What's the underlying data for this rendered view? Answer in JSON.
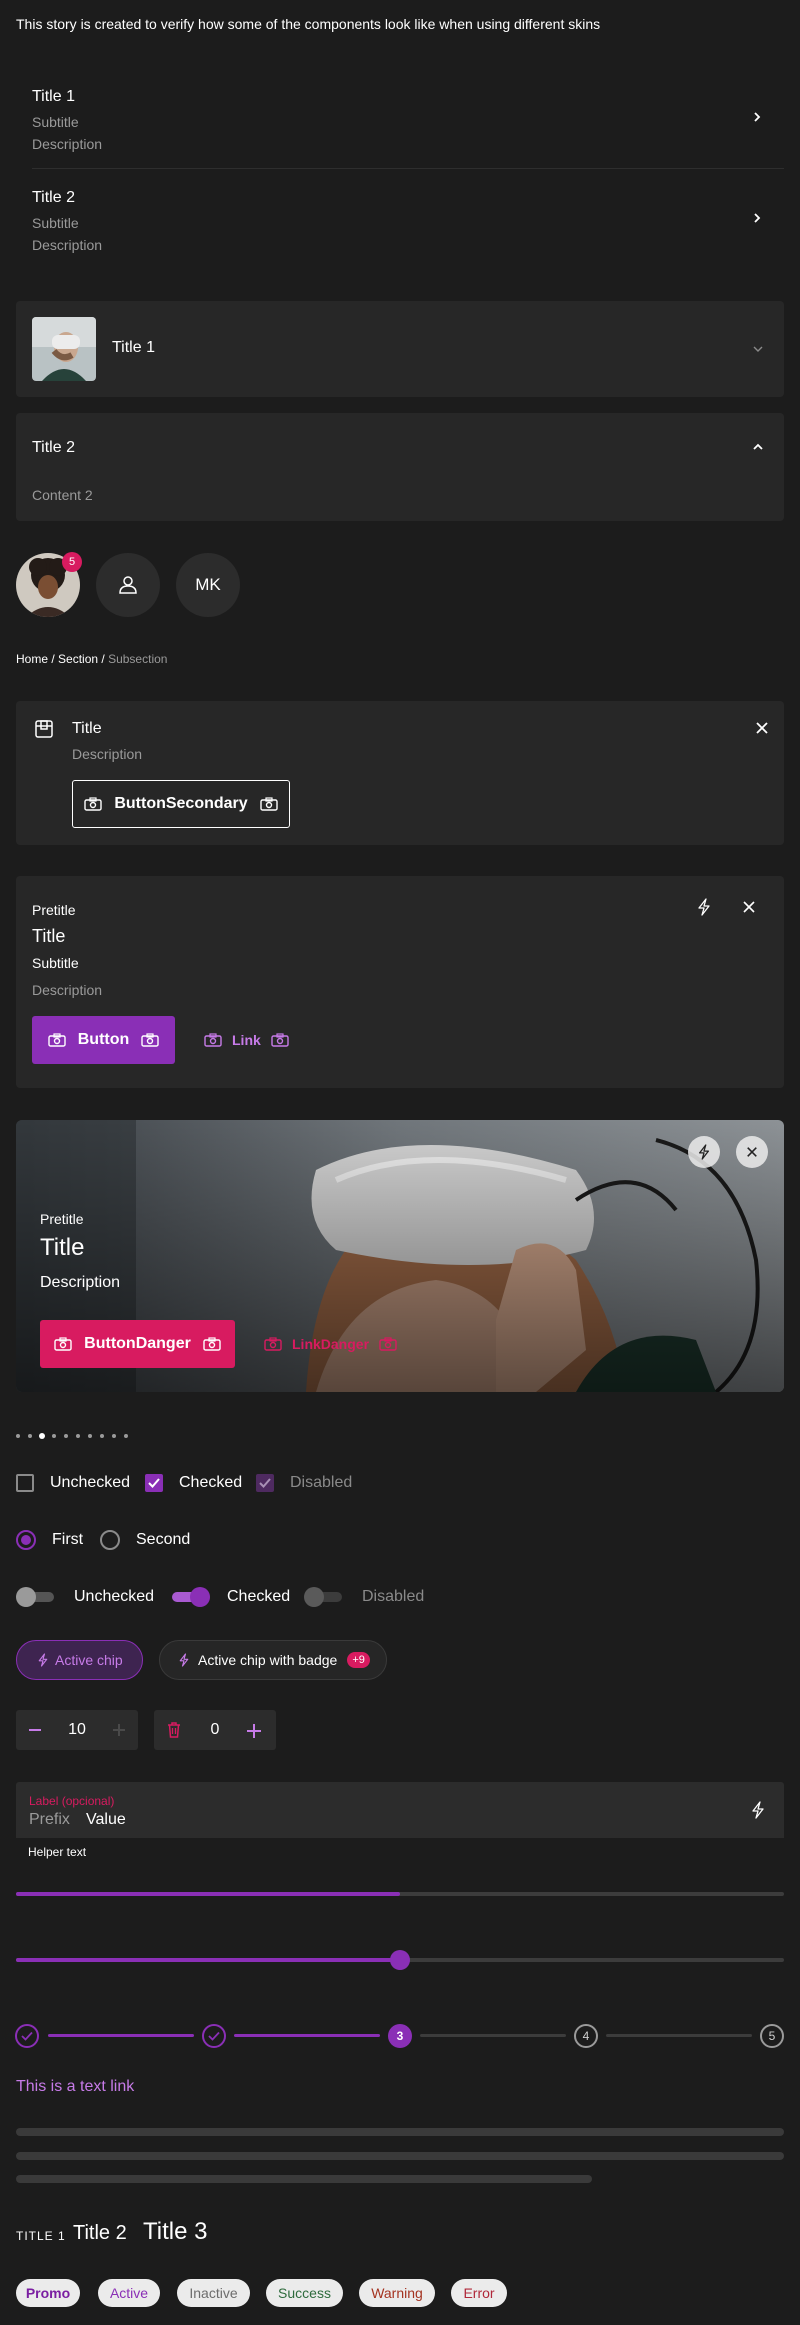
{
  "intro": "This story is created to verify how some of the components look like when using different skins",
  "list": [
    {
      "title": "Title 1",
      "subtitle": "Subtitle",
      "description": "Description"
    },
    {
      "title": "Title 2",
      "subtitle": "Subtitle",
      "description": "Description"
    }
  ],
  "accordion": [
    {
      "title": "Title 1",
      "expanded": false
    },
    {
      "title": "Title 2",
      "expanded": true,
      "content": "Content 2"
    }
  ],
  "avatars": {
    "badge": "5",
    "initials": "MK"
  },
  "breadcrumb": {
    "items": [
      "Home",
      "Section"
    ],
    "separator": " / ",
    "current": "Subsection"
  },
  "callout": {
    "title": "Title",
    "description": "Description",
    "button": "ButtonSecondary"
  },
  "card": {
    "pretitle": "Pretitle",
    "title": "Title",
    "subtitle": "Subtitle",
    "description": "Description",
    "button": "Button",
    "link": "Link"
  },
  "hero_card": {
    "pretitle": "Pretitle",
    "title": "Title",
    "description": "Description",
    "button": "ButtonDanger",
    "link": "LinkDanger"
  },
  "pager": {
    "count": 10,
    "active_index": 2
  },
  "checkboxes": [
    {
      "label": "Unchecked",
      "checked": false,
      "disabled": false
    },
    {
      "label": "Checked",
      "checked": true,
      "disabled": false
    },
    {
      "label": "Disabled",
      "checked": true,
      "disabled": true
    }
  ],
  "radios": [
    {
      "label": "First",
      "selected": true
    },
    {
      "label": "Second",
      "selected": false
    }
  ],
  "switches": [
    {
      "label": "Unchecked",
      "on": false,
      "disabled": false
    },
    {
      "label": "Checked",
      "on": true,
      "disabled": false
    },
    {
      "label": "Disabled",
      "on": false,
      "disabled": true
    }
  ],
  "chips": [
    {
      "label": "Active chip",
      "active": true
    },
    {
      "label": "Active chip with badge",
      "badge": "+9"
    }
  ],
  "steppers": [
    {
      "value": "10"
    },
    {
      "value": "0"
    }
  ],
  "text_field": {
    "label": "Label (opcional)",
    "prefix": "Prefix",
    "value": "Value",
    "helper": "Helper text"
  },
  "progress": {
    "value": 0.5
  },
  "slider": {
    "value": 0.5
  },
  "step_indicator": {
    "steps": [
      "1",
      "2",
      "3",
      "4",
      "5"
    ],
    "current": 3
  },
  "text_link": "This is a text link",
  "titles": {
    "title1": "TITLE 1",
    "title2": "Title 2",
    "title3": "Title 3"
  },
  "tags": [
    {
      "label": "Promo",
      "color": "#7b1fa2"
    },
    {
      "label": "Active",
      "color": "#8a2fb6"
    },
    {
      "label": "Inactive",
      "color": "#6d6d6d"
    },
    {
      "label": "Success",
      "color": "#2e6b3d"
    },
    {
      "label": "Warning",
      "color": "#a4321f"
    },
    {
      "label": "Error",
      "color": "#b0283a"
    }
  ],
  "colors": {
    "background": "#1c1c1c",
    "surface": "#272727",
    "brand": "#8a2fb6",
    "danger": "#d81b60",
    "muted": "#9a9a9a"
  }
}
